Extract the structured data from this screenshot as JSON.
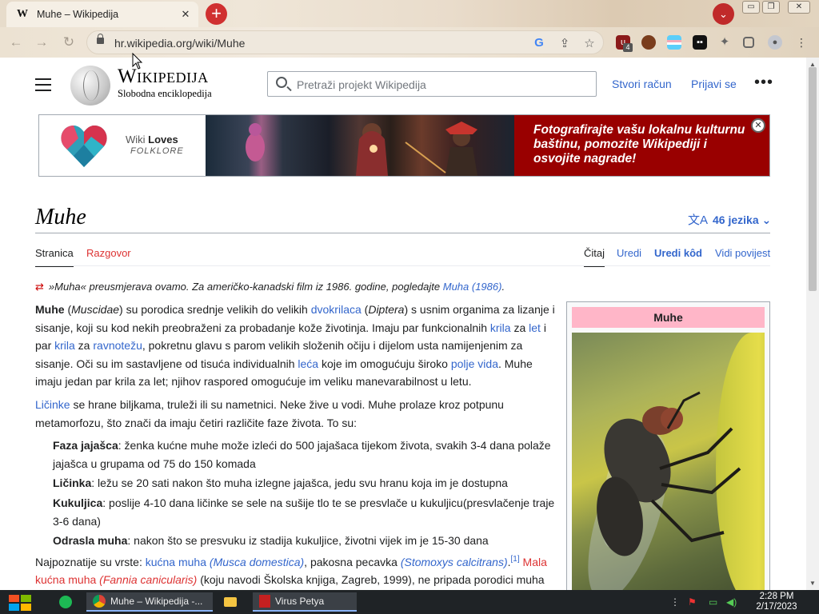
{
  "browser": {
    "tab_title": "Muhe – Wikipedija",
    "tab_favicon": "W",
    "tab_close": "✕",
    "url": "hr.wikipedia.org/wiki/Muhe",
    "extension_badge": "4",
    "window_buttons": [
      "▭",
      "❐",
      "✕"
    ]
  },
  "wiki": {
    "wordmark": "Wikipedija",
    "tagline": "Slobodna enciklopedija",
    "search_placeholder": "Pretraži projekt Wikipedija",
    "create_account": "Stvori račun",
    "login": "Prijavi se",
    "more": "•••"
  },
  "banner": {
    "wiki_loves_1": "Wiki",
    "wiki_loves_2": "Loves",
    "folklore": "FOLKLORE",
    "message": "Fotografirajte vašu lokalnu kulturnu baštinu, pomozite Wikipediji i osvojite nagrade!",
    "close": "✕"
  },
  "article": {
    "title": "Muhe",
    "languages": "46 jezika",
    "tabs_left": [
      "Stranica",
      "Razgovor"
    ],
    "tabs_right": [
      "Čitaj",
      "Uredi",
      "Uredi kôd",
      "Vidi povijest"
    ],
    "hatnote_text": "»Muha« preusmjerava ovamo. Za američko-kanadski film iz 1986. godine, pogledajte ",
    "hatnote_link": "Muha (1986)",
    "hatnote_end": ".",
    "infobox_title": "Muhe"
  },
  "taskbar": {
    "chrome_item": "Muhe – Wikipedija -...",
    "virus_item": "Virus Petya",
    "time": "2:28 PM",
    "date": "2/17/2023"
  },
  "colors": {
    "link": "#3366cc",
    "redlink": "#d33",
    "banner_red": "#990000",
    "infobox_header": "#ffb6c8"
  }
}
